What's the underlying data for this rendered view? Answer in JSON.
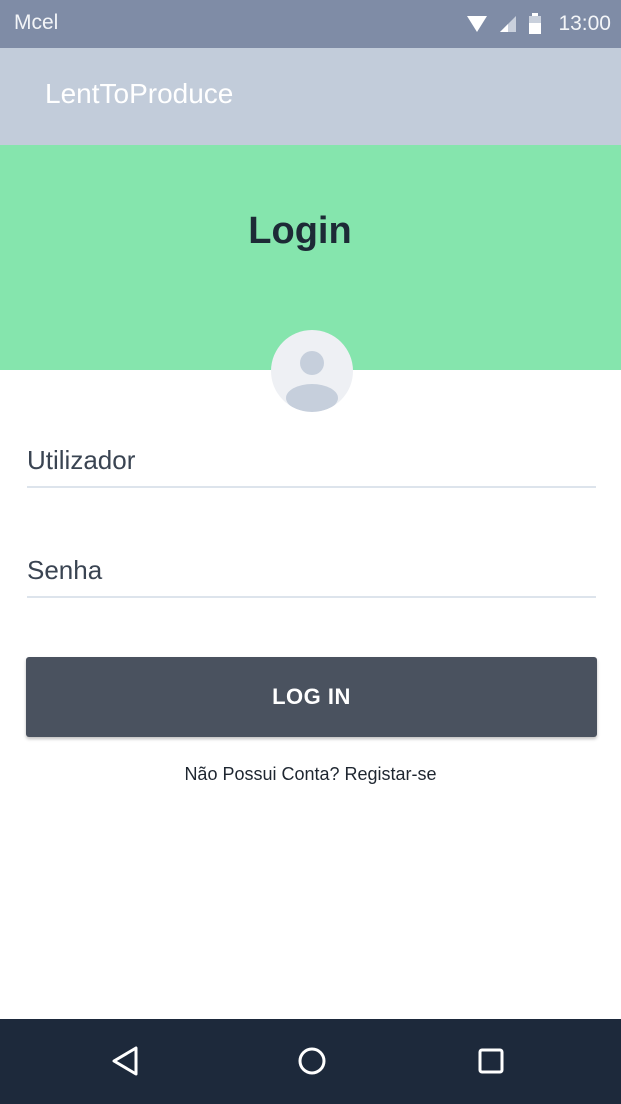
{
  "status_bar": {
    "carrier": "Mcel",
    "time": "13:00",
    "icons": [
      "wifi-icon",
      "signal-icon",
      "battery-icon"
    ]
  },
  "app_bar": {
    "title": "LentToProduce"
  },
  "header": {
    "title": "Login"
  },
  "avatar": {
    "icon": "user-avatar-icon"
  },
  "form": {
    "username_placeholder": "Utilizador",
    "password_placeholder": "Senha",
    "login_button_label": "LOG IN",
    "register_link": "Não Possui Conta? Registar-se"
  },
  "nav_bar": {
    "buttons": [
      "back-icon",
      "home-icon",
      "recent-apps-icon"
    ]
  },
  "colors": {
    "status_bar": "#7f8ca6",
    "app_bar": "#c2ccda",
    "header": "#85e5ad",
    "button": "#4a525f",
    "nav_bar": "#1d293b"
  }
}
